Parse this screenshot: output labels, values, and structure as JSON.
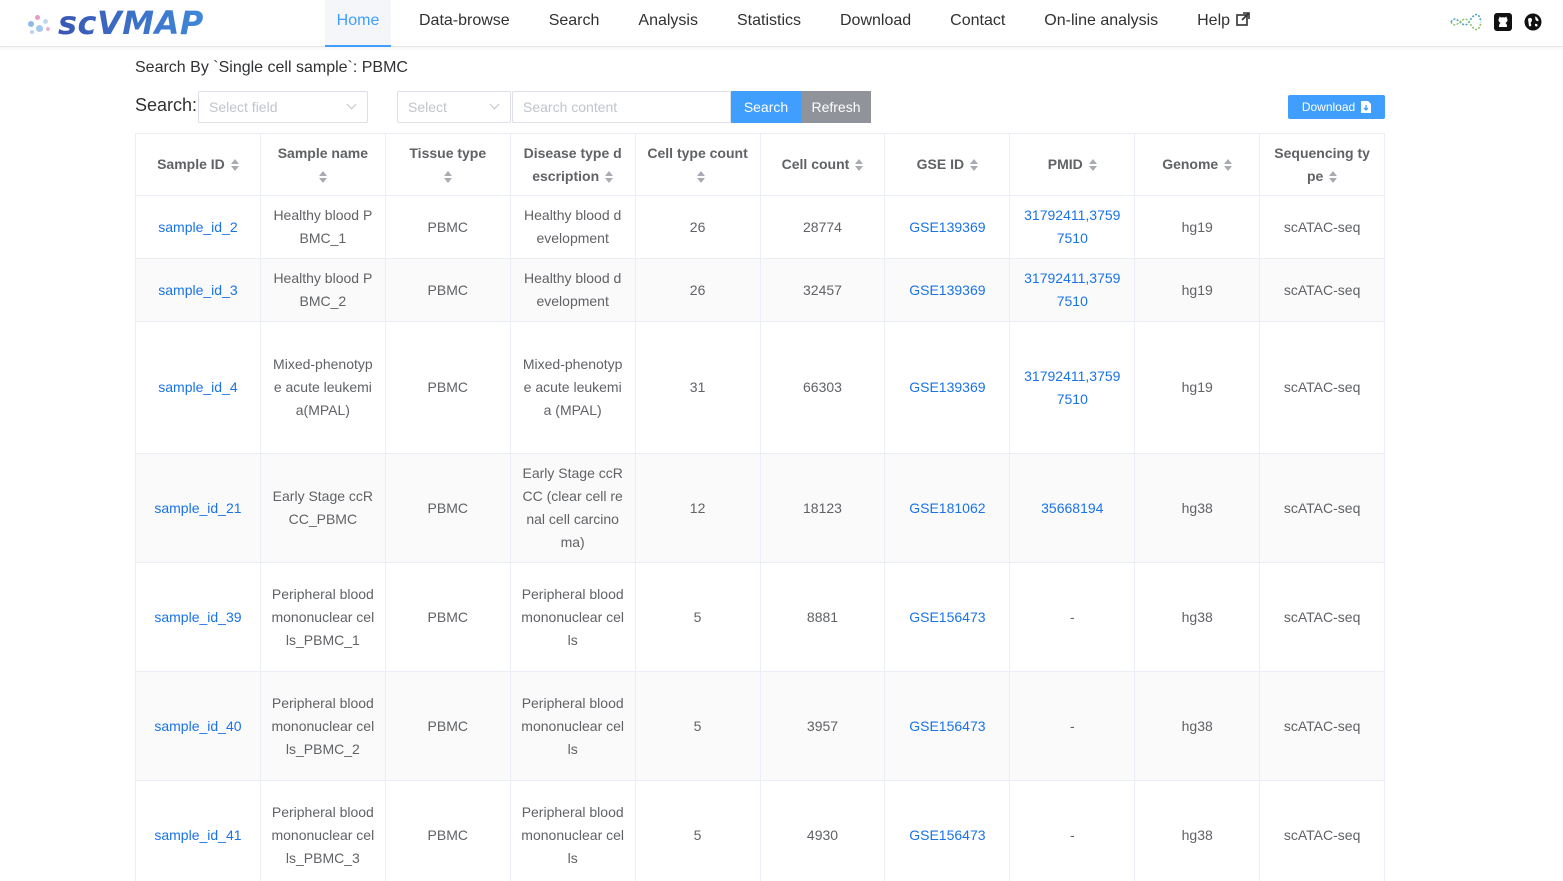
{
  "app": {
    "logo_text": "scVMAP"
  },
  "nav": {
    "items": [
      {
        "label": "Home",
        "active": true
      },
      {
        "label": "Data-browse"
      },
      {
        "label": "Search"
      },
      {
        "label": "Analysis"
      },
      {
        "label": "Statistics"
      },
      {
        "label": "Download"
      },
      {
        "label": "Contact"
      },
      {
        "label": "On-line analysis"
      },
      {
        "label": "Help"
      }
    ],
    "icons": [
      "dna-logo-icon",
      "github-icon",
      "globe-icon"
    ]
  },
  "breadcrumb": "Search By `Single cell sample`: PBMC",
  "search": {
    "label": "Search:",
    "field_placeholder": "Select field",
    "select_placeholder": "Select",
    "content_placeholder": "Search content",
    "search_button": "Search",
    "refresh_button": "Refresh",
    "download_button": "Download"
  },
  "table": {
    "headers": [
      "Sample ID",
      "Sample name",
      "Tissue type",
      "Disease type description",
      "Cell type count",
      "Cell count",
      "GSE ID",
      "PMID",
      "Genome",
      "Sequencing type"
    ],
    "rows": [
      [
        "sample_id_2",
        "Healthy blood PBMC_1",
        "PBMC",
        "Healthy blood development",
        "26",
        "28774",
        "GSE139369",
        "31792411,37597510",
        "hg19",
        "scATAC-seq"
      ],
      [
        "sample_id_3",
        "Healthy blood PBMC_2",
        "PBMC",
        "Healthy blood development",
        "26",
        "32457",
        "GSE139369",
        "31792411,37597510",
        "hg19",
        "scATAC-seq"
      ],
      [
        "sample_id_4",
        "Mixed-phenotype acute leukemia(MPAL)",
        "PBMC",
        "Mixed-phenotype acute leukemia (MPAL)",
        "31",
        "66303",
        "GSE139369",
        "31792411,37597510",
        "hg19",
        "scATAC-seq"
      ],
      [
        "sample_id_21",
        "Early Stage ccRCC_PBMC",
        "PBMC",
        "Early Stage ccRCC (clear cell renal cell carcinoma)",
        "12",
        "18123",
        "GSE181062",
        "35668194",
        "hg38",
        "scATAC-seq"
      ],
      [
        "sample_id_39",
        "Peripheral blood mononuclear cells_PBMC_1",
        "PBMC",
        "Peripheral blood mononuclear cells",
        "5",
        "8881",
        "GSE156473",
        "-",
        "hg38",
        "scATAC-seq"
      ],
      [
        "sample_id_40",
        "Peripheral blood mononuclear cells_PBMC_2",
        "PBMC",
        "Peripheral blood mononuclear cells",
        "5",
        "3957",
        "GSE156473",
        "-",
        "hg38",
        "scATAC-seq"
      ],
      [
        "sample_id_41",
        "Peripheral blood mononuclear cells_PBMC_3",
        "PBMC",
        "Peripheral blood mononuclear cells",
        "5",
        "4930",
        "GSE156473",
        "-",
        "hg38",
        "scATAC-seq"
      ]
    ]
  },
  "colors": {
    "accent": "#409eff",
    "link": "#1a73e8",
    "refresh": "#909399"
  }
}
